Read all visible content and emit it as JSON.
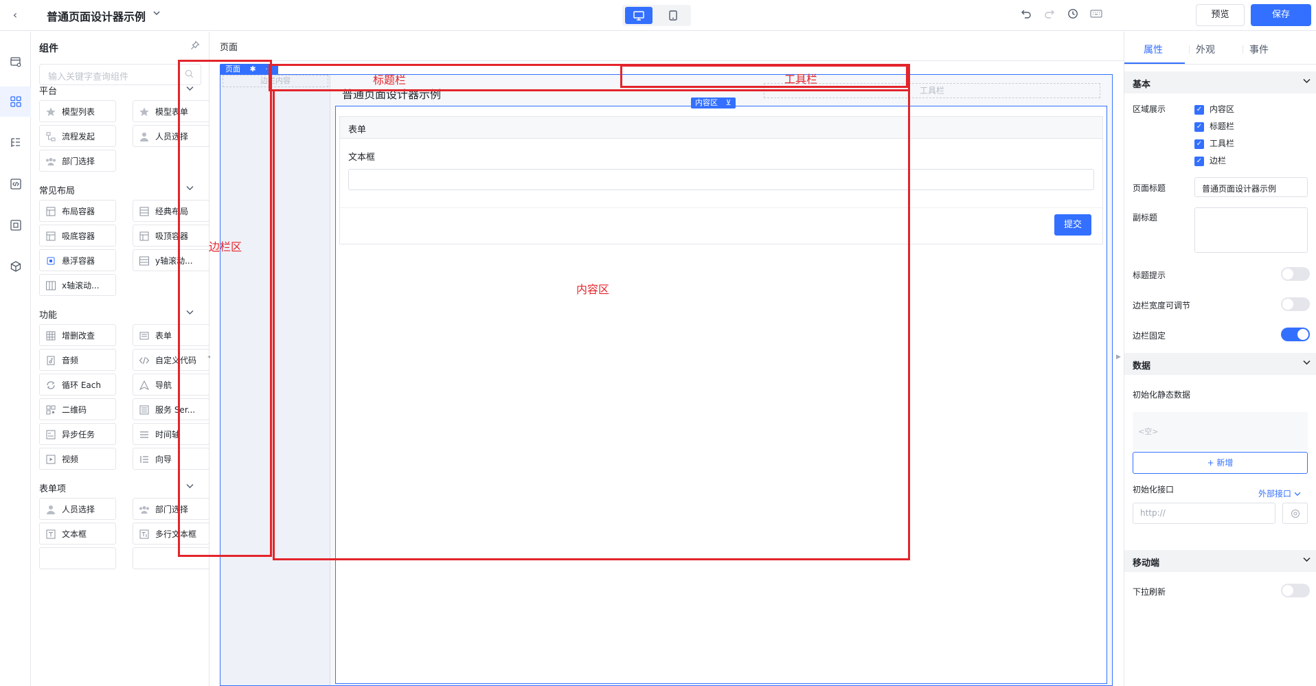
{
  "header": {
    "back": "‹",
    "title": "普通页面设计器示例",
    "preview_label": "预览",
    "save_label": "保存"
  },
  "component_panel": {
    "title": "组件",
    "search_placeholder": "输入关键字查询组件",
    "sections": [
      {
        "title": "平台",
        "items": [
          "模型列表",
          "模型表单",
          "流程发起",
          "人员选择",
          "部门选择"
        ]
      },
      {
        "title": "常见布局",
        "items": [
          "布局容器",
          "经典布局",
          "吸底容器",
          "吸顶容器",
          "悬浮容器",
          "y轴滚动...",
          "x轴滚动..."
        ]
      },
      {
        "title": "功能",
        "items": [
          "增删改查",
          "表单",
          "音频",
          "自定义代码",
          "循环 Each",
          "导航",
          "二维码",
          "服务 Ser...",
          "异步任务",
          "时间轴",
          "视频",
          "向导"
        ]
      },
      {
        "title": "表单项",
        "items": [
          "人员选择",
          "部门选择",
          "文本框",
          "多行文本框"
        ]
      }
    ]
  },
  "canvas": {
    "breadcrumb": "页面",
    "page_tag": "页面",
    "sidebar_placeholder": "边栏内容",
    "page_title": "普通页面设计器示例",
    "toolbar_placeholder": "工具栏",
    "content_tag": "内容区",
    "form": {
      "title": "表单",
      "field_label": "文本框",
      "submit_label": "提交"
    },
    "annotations": {
      "sidebar": "边栏区",
      "titlebar": "标题栏",
      "toolbar": "工具栏",
      "content": "内容区"
    }
  },
  "props_panel": {
    "tabs": [
      "属性",
      "外观",
      "事件"
    ],
    "active_tab": "属性",
    "basic": {
      "title": "基本",
      "region_label": "区域展示",
      "regions": [
        "内容区",
        "标题栏",
        "工具栏",
        "边栏"
      ],
      "page_title_label": "页面标题",
      "page_title_value": "普通页面设计器示例",
      "subtitle_label": "副标题",
      "title_tip_label": "标题提示",
      "sidebar_width_label": "边栏宽度可调节",
      "sidebar_fixed_label": "边栏固定",
      "title_tip_on": false,
      "sidebar_width_on": false,
      "sidebar_fixed_on": true
    },
    "data": {
      "title": "数据",
      "init_static_label": "初始化静态数据",
      "empty_text": "<空>",
      "add_label": "+ 新增",
      "init_api_label": "初始化接口",
      "external_api_label": "外部接口",
      "url_placeholder": "http://"
    },
    "mobile": {
      "title": "移动端",
      "pull_refresh_label": "下拉刷新",
      "pull_refresh_on": false
    }
  },
  "colors": {
    "accent": "#3370ff",
    "annotation": "#e3242b"
  }
}
